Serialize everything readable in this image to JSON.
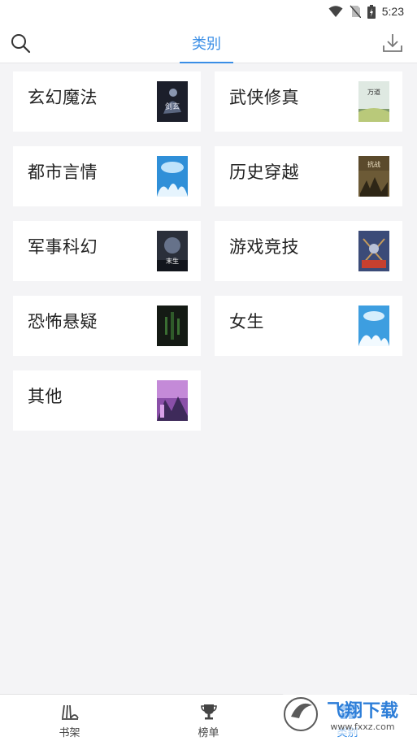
{
  "status_bar": {
    "time": "5:23"
  },
  "header": {
    "title": "类别"
  },
  "categories": [
    {
      "label": "玄幻魔法",
      "cover_color": "#1c1f2b",
      "cover_title": "剑玄"
    },
    {
      "label": "武侠修真",
      "cover_color": "#dfe9e2",
      "cover_title": "万道"
    },
    {
      "label": "都市言情",
      "cover_color": "#2f8fd8",
      "cover_title": ""
    },
    {
      "label": "历史穿越",
      "cover_color": "#5b4a2c",
      "cover_title": "抗战"
    },
    {
      "label": "军事科幻",
      "cover_color": "#2a2f3a",
      "cover_title": "末生"
    },
    {
      "label": "游戏竞技",
      "cover_color": "#3b4b78",
      "cover_title": ""
    },
    {
      "label": "恐怖悬疑",
      "cover_color": "#141a14",
      "cover_title": ""
    },
    {
      "label": "女生",
      "cover_color": "#3d9ee0",
      "cover_title": ""
    },
    {
      "label": "其他",
      "cover_color": "#8a4fa8",
      "cover_title": ""
    }
  ],
  "tabbar": {
    "tabs": [
      {
        "label": "书架",
        "icon": "bookshelf-icon"
      },
      {
        "label": "榜单",
        "icon": "trophy-icon"
      },
      {
        "label": "类别",
        "icon": "category-icon"
      }
    ],
    "active": "类别"
  },
  "watermark": {
    "text": "飞翔下载",
    "sub": "www.fxxz.com"
  },
  "colors": {
    "accent": "#3a8ee6",
    "background": "#f4f4f6",
    "card": "#ffffff"
  }
}
